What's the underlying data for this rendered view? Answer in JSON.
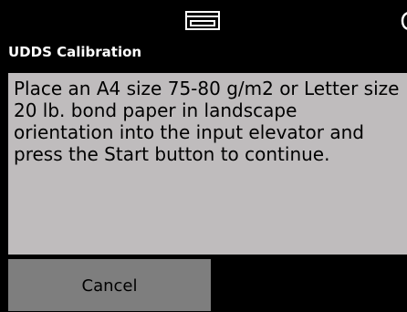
{
  "status_bar": {
    "icon": "paper-tray-icon",
    "partial_icon": "partial-status-icon"
  },
  "header": {
    "title": "UDDS Calibration"
  },
  "message": {
    "text": "Place an A4 size 75-80 g/m2 or Letter size 20 lb. bond paper in landscape orientation into the input elevator and press the Start button to continue."
  },
  "footer": {
    "cancel_label": "Cancel"
  },
  "colors": {
    "background": "#000000",
    "panel": "#bfbcbd",
    "button": "#7e7e7e",
    "title_text": "#ffffff",
    "body_text": "#000000"
  }
}
